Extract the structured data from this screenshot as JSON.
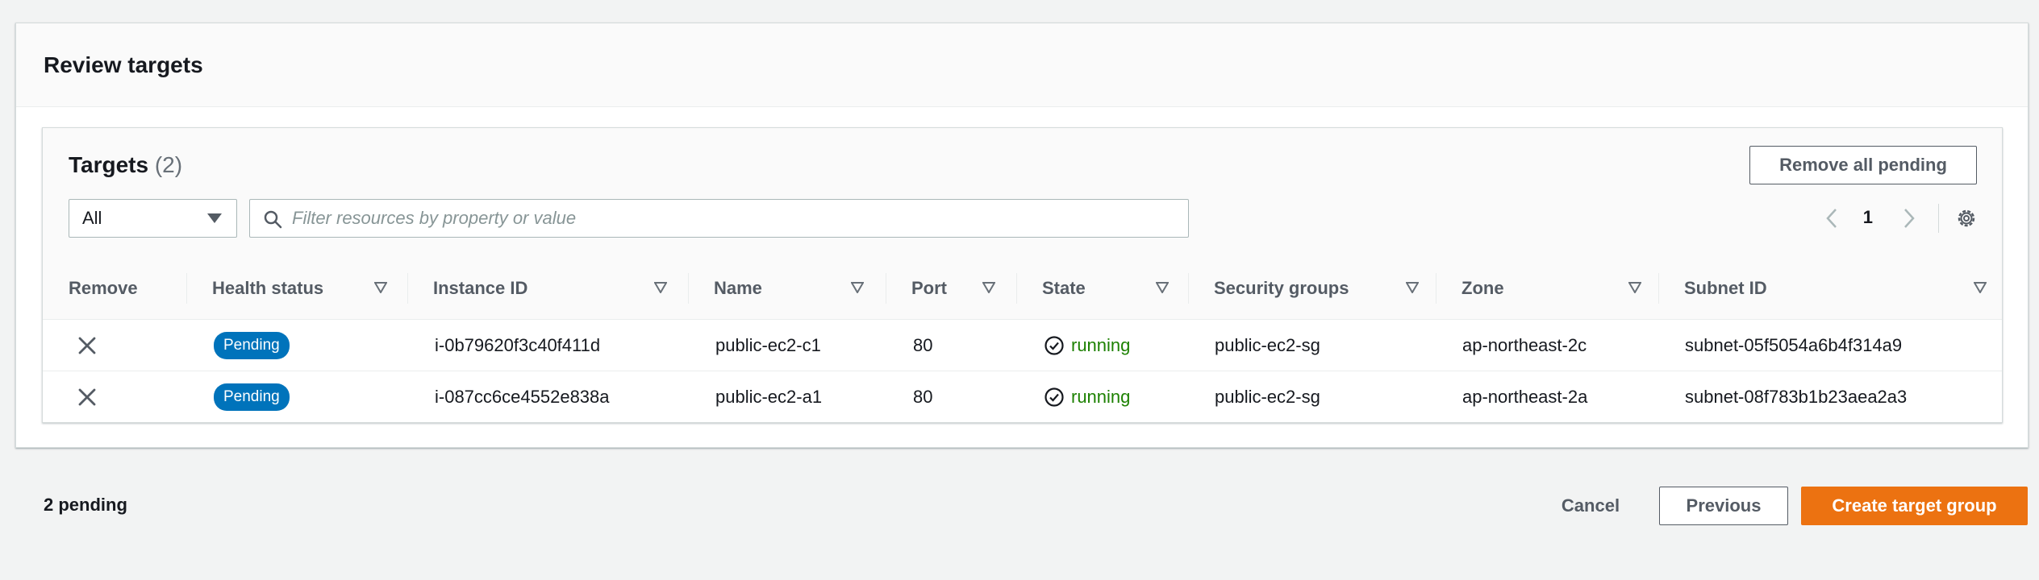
{
  "review": {
    "title": "Review targets"
  },
  "targets": {
    "title": "Targets",
    "count": "(2)",
    "remove_all_label": "Remove all pending",
    "filter_select_value": "All",
    "search_placeholder": "Filter resources by property or value",
    "current_page": "1",
    "columns": [
      {
        "label": "Remove",
        "sortable": false
      },
      {
        "label": "Health status",
        "sortable": true
      },
      {
        "label": "Instance ID",
        "sortable": true
      },
      {
        "label": "Name",
        "sortable": true
      },
      {
        "label": "Port",
        "sortable": true
      },
      {
        "label": "State",
        "sortable": true
      },
      {
        "label": "Security groups",
        "sortable": true
      },
      {
        "label": "Zone",
        "sortable": true
      },
      {
        "label": "Subnet ID",
        "sortable": true
      }
    ],
    "rows": [
      {
        "health_status": "Pending",
        "instance_id": "i-0b79620f3c40f411d",
        "name": "public-ec2-c1",
        "port": "80",
        "state": "running",
        "security_groups": "public-ec2-sg",
        "zone": "ap-northeast-2c",
        "subnet_id": "subnet-05f5054a6b4f314a9"
      },
      {
        "health_status": "Pending",
        "instance_id": "i-087cc6ce4552e838a",
        "name": "public-ec2-a1",
        "port": "80",
        "state": "running",
        "security_groups": "public-ec2-sg",
        "zone": "ap-northeast-2a",
        "subnet_id": "subnet-08f783b1b23aea2a3"
      }
    ]
  },
  "footer": {
    "pending_text": "2 pending",
    "cancel_label": "Cancel",
    "previous_label": "Previous",
    "create_label": "Create target group"
  },
  "colors": {
    "primary_button": "#ec7211",
    "badge_pending": "#0073bb",
    "state_running": "#1d8102"
  },
  "icons": {
    "filter_caret": "caret-down-icon",
    "search": "search-icon",
    "pager_prev": "chevron-left-icon",
    "pager_next": "chevron-right-icon",
    "settings": "gear-icon",
    "sort": "sort-caret-icon",
    "remove": "close-icon",
    "state": "check-circle-icon"
  }
}
